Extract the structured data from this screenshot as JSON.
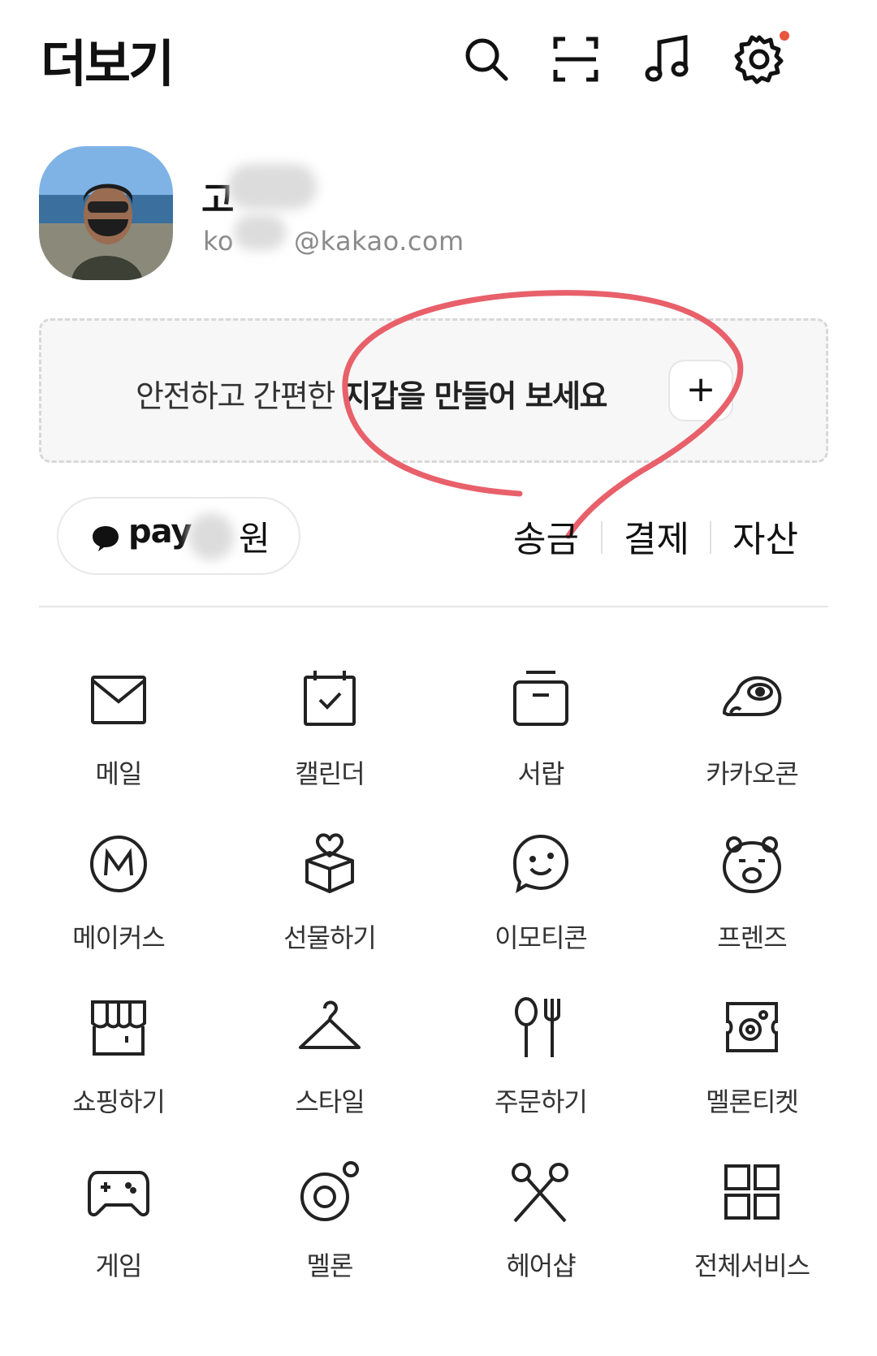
{
  "header": {
    "title": "더보기",
    "icons": [
      "search-icon",
      "scan-icon",
      "music-icon",
      "settings-icon"
    ],
    "has_notification": true
  },
  "profile": {
    "name_visible": "고",
    "email_prefix": "ko",
    "email_suffix": "@kakao.com"
  },
  "wallet": {
    "text_normal": "안전하고 간편한 ",
    "text_bold": "지갑을 만들어 보세요",
    "plus": "+"
  },
  "pay": {
    "label": "pay",
    "currency": "원",
    "actions": [
      "송금",
      "결제",
      "자산"
    ]
  },
  "services": [
    {
      "label": "메일",
      "icon": "mail-icon"
    },
    {
      "label": "캘린더",
      "icon": "calendar-icon"
    },
    {
      "label": "서랍",
      "icon": "drawer-icon"
    },
    {
      "label": "카카오콘",
      "icon": "kakaocon-icon"
    },
    {
      "label": "메이커스",
      "icon": "makers-icon"
    },
    {
      "label": "선물하기",
      "icon": "gift-icon"
    },
    {
      "label": "이모티콘",
      "icon": "emoticon-icon"
    },
    {
      "label": "프렌즈",
      "icon": "friends-icon"
    },
    {
      "label": "쇼핑하기",
      "icon": "shopping-icon"
    },
    {
      "label": "스타일",
      "icon": "hanger-icon"
    },
    {
      "label": "주문하기",
      "icon": "order-icon"
    },
    {
      "label": "멜론티켓",
      "icon": "melon-ticket-icon"
    },
    {
      "label": "게임",
      "icon": "game-icon"
    },
    {
      "label": "멜론",
      "icon": "melon-icon"
    },
    {
      "label": "헤어샵",
      "icon": "scissors-icon"
    },
    {
      "label": "전체서비스",
      "icon": "all-services-icon"
    }
  ],
  "colors": {
    "notification": "#e8563c",
    "annotation": "#e8606a"
  }
}
